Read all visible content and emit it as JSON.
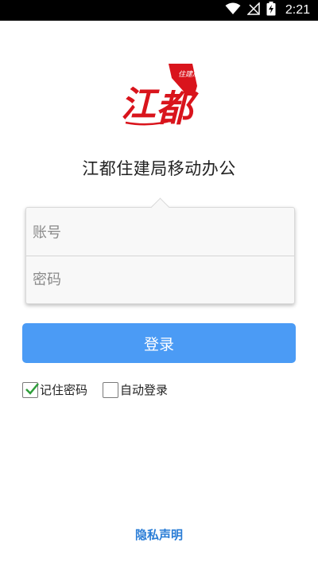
{
  "status_bar": {
    "time": "2:21",
    "icons": [
      "wifi-icon",
      "no-signal-icon",
      "battery-charging-icon"
    ]
  },
  "logo": {
    "text": "江都",
    "badge_text": "住建局",
    "icon": "jiangdu-logo-icon",
    "color": "#d9141c"
  },
  "app_title": "江都住建局移动办公",
  "login_form": {
    "account_placeholder": "账号",
    "account_value": "",
    "password_placeholder": "密码",
    "password_value": ""
  },
  "login_button": {
    "label": "登录",
    "color": "#4b9bf5"
  },
  "options": {
    "remember_password": {
      "label": "记住密码",
      "checked": true
    },
    "auto_login": {
      "label": "自动登录",
      "checked": false
    }
  },
  "privacy_link": {
    "label": "隐私声明",
    "color": "#2a7dd6"
  }
}
